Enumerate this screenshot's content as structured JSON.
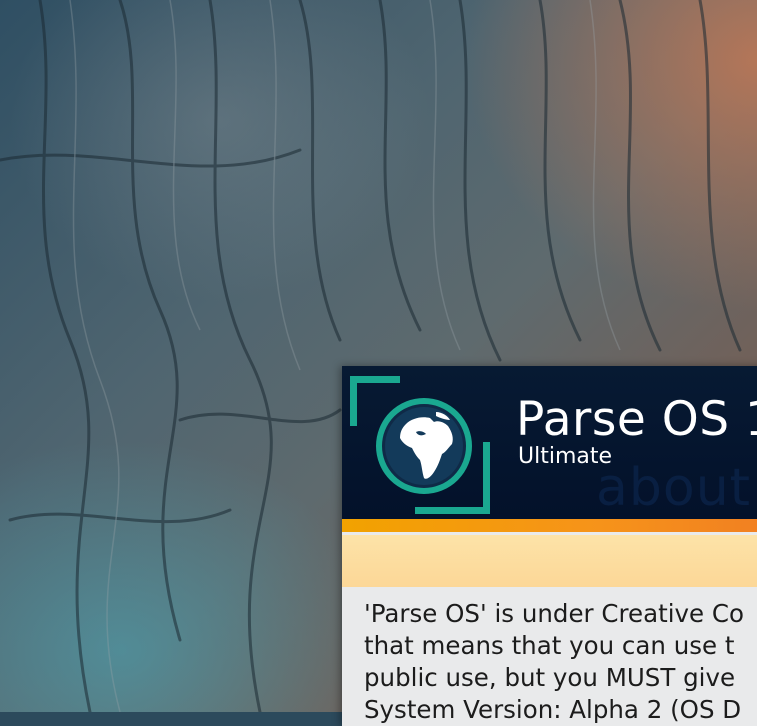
{
  "window": {
    "title": "Parse OS 1",
    "edition": "Ultimate",
    "watermark": "about",
    "license_lines": [
      "'Parse OS' is under Creative Co",
      "that means that you can use t",
      "public use, but you MUST give",
      "System Version: Alpha 2 (OS D"
    ]
  },
  "icons": {
    "app_logo": "globe-icon"
  },
  "colors": {
    "header_bg": "#051631",
    "accent_teal": "#1aa890",
    "orange_bar": "#f59a12",
    "banner": "#fcdc9c",
    "body_bg": "#e9eaeb"
  }
}
